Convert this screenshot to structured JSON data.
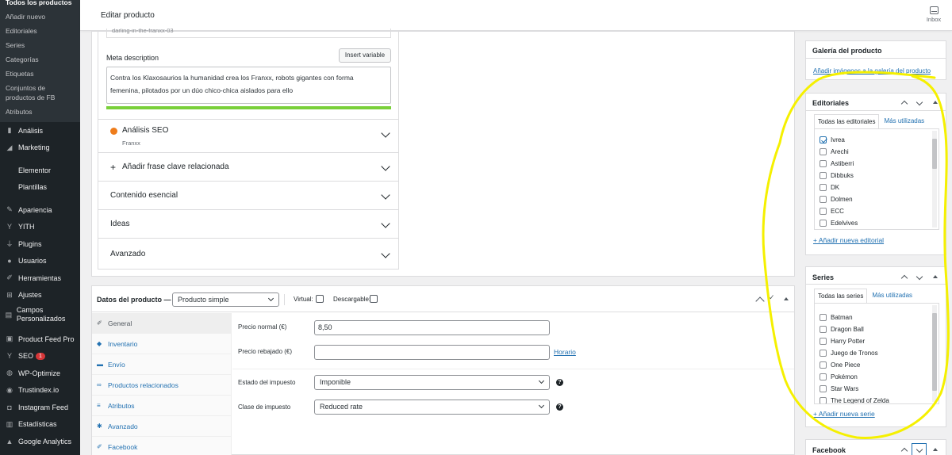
{
  "sidebar": {
    "subitems": [
      "Todos los productos",
      "Añadir nuevo",
      "Editoriales",
      "Series",
      "Categorías",
      "Etiquetas",
      "Conjuntos de productos de FB",
      "Atributos"
    ],
    "menu": [
      {
        "label": "Análisis",
        "icon": "chart-bar-icon"
      },
      {
        "label": "Marketing",
        "icon": "megaphone-icon"
      },
      {
        "label": "Elementor",
        "icon": ""
      },
      {
        "label": "Plantillas",
        "icon": ""
      },
      {
        "label": "Apariencia",
        "icon": "paintbrush-icon"
      },
      {
        "label": "YITH",
        "icon": "yith-icon"
      },
      {
        "label": "Plugins",
        "icon": "plug-icon"
      },
      {
        "label": "Usuarios",
        "icon": "users-icon"
      },
      {
        "label": "Herramientas",
        "icon": "wrench-icon"
      },
      {
        "label": "Ajustes",
        "icon": "settings-icon"
      },
      {
        "label": "Campos Personalizados",
        "icon": "fields-icon"
      },
      {
        "label": "Product Feed Pro",
        "icon": "feed-icon"
      },
      {
        "label": "SEO",
        "icon": "yoast-icon",
        "badge": "1"
      },
      {
        "label": "WP-Optimize",
        "icon": "optimize-icon"
      },
      {
        "label": "Trustindex.io",
        "icon": "star-icon"
      },
      {
        "label": "Instagram Feed",
        "icon": "instagram-icon"
      },
      {
        "label": "Estadísticas",
        "icon": "stats-icon"
      },
      {
        "label": "Google Analytics",
        "icon": "analytics-icon"
      }
    ]
  },
  "topbar": {
    "title": "Editar producto",
    "inbox": "Inbox"
  },
  "seo": {
    "slug": "darling-in-the-franxx-03",
    "meta_label": "Meta description",
    "insert_variable": "Insert variable",
    "meta_line1": "Contra los Klaxosaurios la humanidad crea los Franxx, robots gigantes con forma",
    "meta_line2": "femenina, pilotados por un dúo chico-chica aislados para ello",
    "analysis_label": "Análisis SEO",
    "analysis_sub": "Franxx",
    "related": "Añadir frase clave relacionada",
    "cornerstone": "Contenido esencial",
    "ideas": "Ideas",
    "advanced": "Avanzado"
  },
  "product_data": {
    "title": "Datos del producto —",
    "type": "Producto simple",
    "virtual": "Virtual:",
    "downloadable": "Descargable:",
    "tabs": [
      {
        "label": "General",
        "icon": "wrench-icon"
      },
      {
        "label": "Inventario",
        "icon": "tag-icon"
      },
      {
        "label": "Envío",
        "icon": "truck-icon"
      },
      {
        "label": "Productos relacionados",
        "icon": "link-icon"
      },
      {
        "label": "Atributos",
        "icon": "list-icon"
      },
      {
        "label": "Avanzado",
        "icon": "gear-icon"
      },
      {
        "label": "Facebook",
        "icon": "wrench-icon"
      }
    ],
    "regular_price_label": "Precio normal (€)",
    "regular_price": "8,50",
    "sale_price_label": "Precio rebajado (€)",
    "sale_price": "",
    "schedule": "Horario",
    "tax_status_label": "Estado del impuesto",
    "tax_status": "Imponible",
    "tax_class_label": "Clase de impuesto",
    "tax_class": "Reduced rate"
  },
  "gallery": {
    "title": "Galería del producto",
    "link": "Añadir imágenes a la galería del producto"
  },
  "editoriales": {
    "title": "Editoriales",
    "tab_all": "Todas las editoriales",
    "tab_used": "Más utilizadas",
    "items": [
      "Ivrea",
      "Arechi",
      "Astiberri",
      "Dibbuks",
      "DK",
      "Dolmen",
      "ECC",
      "Edelvives"
    ],
    "checked_index": 0,
    "add": "+ Añadir nueva editorial"
  },
  "series": {
    "title": "Series",
    "tab_all": "Todas las series",
    "tab_used": "Más utilizadas",
    "items": [
      "Batman",
      "Dragon Ball",
      "Harry Potter",
      "Juego de Tronos",
      "One Piece",
      "Pokémon",
      "Star Wars",
      "The Legend of Zelda"
    ],
    "add": "+ Añadir nueva serie"
  },
  "facebook": {
    "title": "Facebook"
  },
  "colors": {
    "accent": "#2271b1",
    "sidebar_bg": "#1d2327",
    "seo_bar": "#7ad03a",
    "annotation": "#f5f000",
    "badge": "#d63638"
  }
}
